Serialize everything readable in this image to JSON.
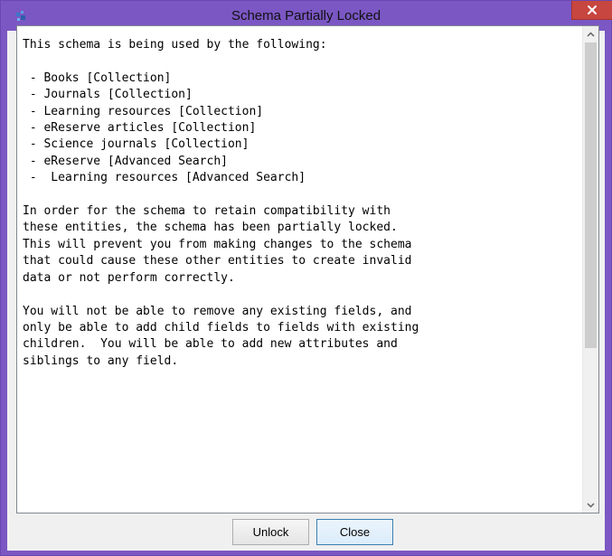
{
  "window": {
    "title": "Schema Partially Locked"
  },
  "message": {
    "lines": [
      "This schema is being used by the following:",
      "",
      " - Books [Collection]",
      " - Journals [Collection]",
      " - Learning resources [Collection]",
      " - eReserve articles [Collection]",
      " - Science journals [Collection]",
      " - eReserve [Advanced Search]",
      " -  Learning resources [Advanced Search]",
      "",
      "In order for the schema to retain compatibility with",
      "these entities, the schema has been partially locked.",
      "This will prevent you from making changes to the schema",
      "that could cause these other entities to create invalid",
      "data or not perform correctly.",
      "",
      "You will not be able to remove any existing fields, and",
      "only be able to add child fields to fields with existing",
      "children.  You will be able to add new attributes and",
      "siblings to any field."
    ]
  },
  "buttons": {
    "unlock_label": "Unlock",
    "close_label": "Close"
  },
  "icons": {
    "app": "app-icon",
    "close": "close-icon",
    "scroll_up": "chevron-up-icon",
    "scroll_down": "chevron-down-icon"
  },
  "colors": {
    "titlebar": "#7b57c4",
    "close_button": "#c7463f"
  }
}
